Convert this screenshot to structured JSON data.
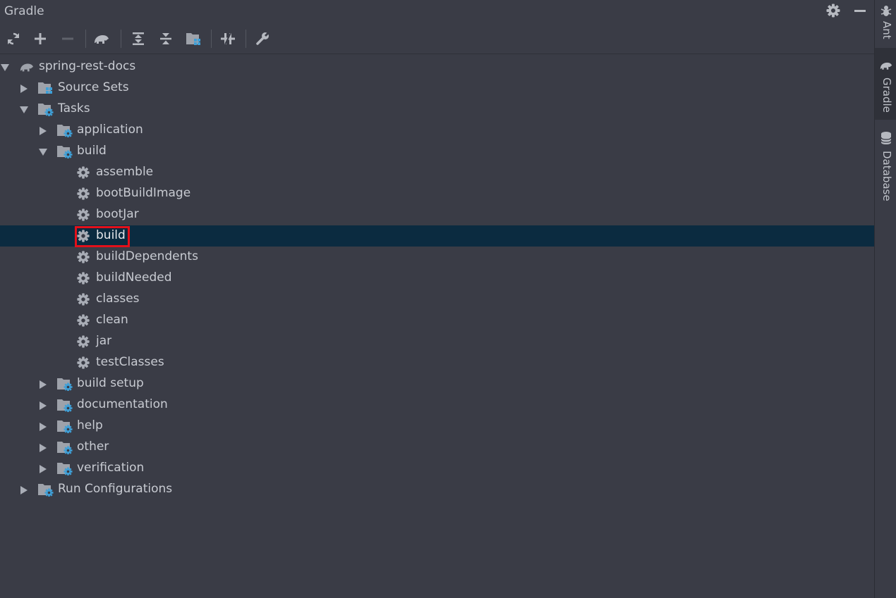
{
  "panel": {
    "title": "Gradle"
  },
  "header": {
    "settings_icon": "gear-icon",
    "minimize_icon": "minus-icon"
  },
  "toolbar": {
    "items": [
      {
        "name": "reload-all-button",
        "icon": "refresh-icon"
      },
      {
        "name": "link-project-button",
        "icon": "plus-icon"
      },
      {
        "name": "unlink-project-button",
        "icon": "minus-icon"
      },
      {
        "name": "execute-task-button",
        "icon": "elephant-icon"
      },
      {
        "name": "expand-all-button",
        "icon": "expand-all-icon"
      },
      {
        "name": "collapse-all-button",
        "icon": "collapse-all-icon"
      },
      {
        "name": "group-modules-button",
        "icon": "module-folder-icon"
      },
      {
        "name": "toggle-offline-button",
        "icon": "offline-icon"
      },
      {
        "name": "build-settings-button",
        "icon": "wrench-icon"
      }
    ]
  },
  "tree": {
    "rows": [
      {
        "label": "spring-rest-docs",
        "level": 0,
        "expanded": true,
        "icon": "gradle-elephant-icon"
      },
      {
        "label": "Source Sets",
        "level": 1,
        "expanded": false,
        "icon": "source-sets-folder-icon"
      },
      {
        "label": "Tasks",
        "level": 1,
        "expanded": true,
        "icon": "task-folder-icon"
      },
      {
        "label": "application",
        "level": 2,
        "expanded": false,
        "icon": "task-folder-icon"
      },
      {
        "label": "build",
        "level": 2,
        "expanded": true,
        "icon": "task-folder-icon"
      },
      {
        "label": "assemble",
        "level": 3,
        "leaf": true,
        "icon": "gear-icon"
      },
      {
        "label": "bootBuildImage",
        "level": 3,
        "leaf": true,
        "icon": "gear-icon"
      },
      {
        "label": "bootJar",
        "level": 3,
        "leaf": true,
        "icon": "gear-icon"
      },
      {
        "label": "build",
        "level": 3,
        "leaf": true,
        "icon": "gear-icon",
        "selected": true
      },
      {
        "label": "buildDependents",
        "level": 3,
        "leaf": true,
        "icon": "gear-icon"
      },
      {
        "label": "buildNeeded",
        "level": 3,
        "leaf": true,
        "icon": "gear-icon"
      },
      {
        "label": "classes",
        "level": 3,
        "leaf": true,
        "icon": "gear-icon"
      },
      {
        "label": "clean",
        "level": 3,
        "leaf": true,
        "icon": "gear-icon"
      },
      {
        "label": "jar",
        "level": 3,
        "leaf": true,
        "icon": "gear-icon"
      },
      {
        "label": "testClasses",
        "level": 3,
        "leaf": true,
        "icon": "gear-icon"
      },
      {
        "label": "build setup",
        "level": 2,
        "expanded": false,
        "icon": "task-folder-icon"
      },
      {
        "label": "documentation",
        "level": 2,
        "expanded": false,
        "icon": "task-folder-icon"
      },
      {
        "label": "help",
        "level": 2,
        "expanded": false,
        "icon": "task-folder-icon"
      },
      {
        "label": "other",
        "level": 2,
        "expanded": false,
        "icon": "task-folder-icon"
      },
      {
        "label": "verification",
        "level": 2,
        "expanded": false,
        "icon": "task-folder-icon"
      },
      {
        "label": "Run Configurations",
        "level": 1,
        "expanded": false,
        "icon": "task-folder-icon"
      }
    ]
  },
  "sidebar_tabs": [
    {
      "label": "Ant",
      "icon": "ant-icon",
      "active": false
    },
    {
      "label": "Gradle",
      "icon": "gradle-elephant-icon",
      "active": true
    },
    {
      "label": "Database",
      "icon": "database-icon",
      "active": false
    }
  ],
  "colors": {
    "background": "#3a3c46",
    "selection": "#0b2b40",
    "highlight_border": "#e3101a",
    "icon_gray": "#a9adb6",
    "icon_blue": "#3fa0d8"
  }
}
